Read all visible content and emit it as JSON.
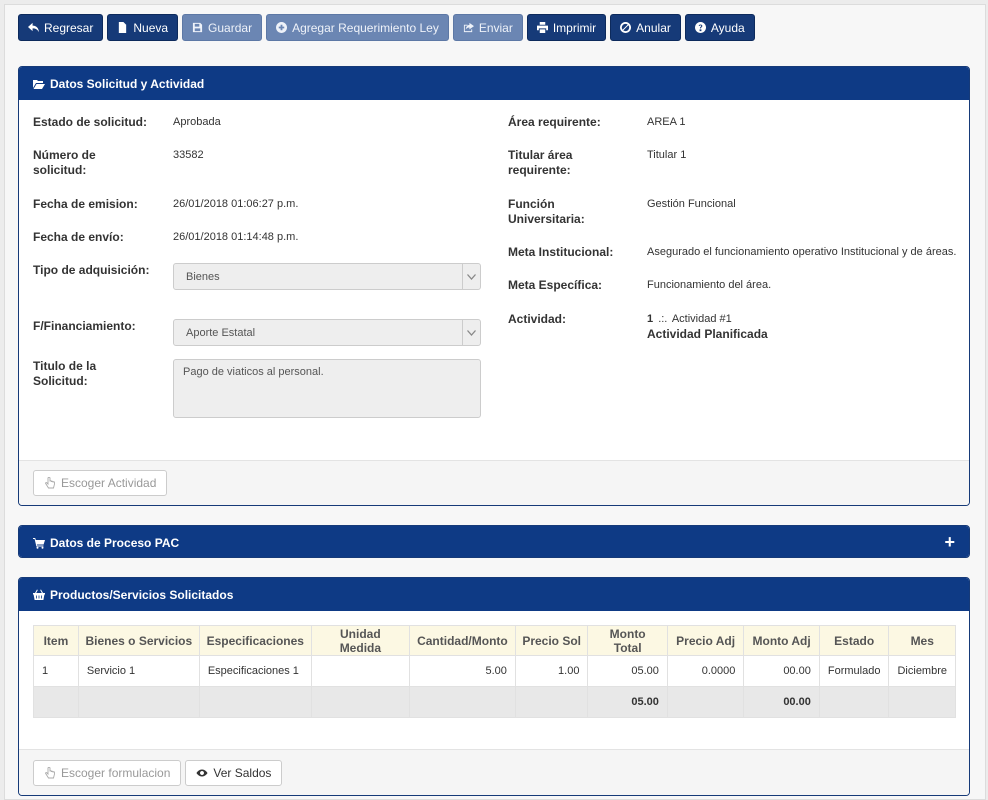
{
  "toolbar": {
    "regresar": "Regresar",
    "nueva": "Nueva",
    "guardar": "Guardar",
    "agregar": "Agregar Requerimiento Ley",
    "enviar": "Enviar",
    "imprimir": "Imprimir",
    "anular": "Anular",
    "ayuda": "Ayuda"
  },
  "solicitud_panel": {
    "title": "Datos Solicitud y Actividad",
    "estado_label": "Estado de solicitud:",
    "estado_value": "Aprobada",
    "numero_label_1": "Número de",
    "numero_label_2": "solicitud:",
    "numero_value": "33582",
    "fecha_emision_label": "Fecha de emision:",
    "fecha_emision_value": "26/01/2018 01:06:27 p.m.",
    "fecha_envio_label": "Fecha de envío:",
    "fecha_envio_value": "26/01/2018 01:14:48 p.m.",
    "tipo_label": "Tipo de adquisición:",
    "tipo_value": "Bienes",
    "financiamiento_label": "F/Financiamiento:",
    "financiamiento_value": "Aporte Estatal",
    "titulo_label_1": "Titulo de la",
    "titulo_label_2": "Solicitud:",
    "titulo_value": "Pago de viaticos al personal.",
    "area_label": "Área requirente:",
    "area_value": "AREA 1",
    "titular_label_1": "Titular área",
    "titular_label_2": "requirente:",
    "titular_value": "Titular 1",
    "funcion_label_1": "Función",
    "funcion_label_2": "Universitaria:",
    "funcion_value": "Gestión Funcional",
    "meta_inst_label": "Meta Institucional:",
    "meta_inst_value": "Asegurado el funcionamiento operativo Institucional y de áreas.",
    "meta_esp_label": "Meta Específica:",
    "meta_esp_value": "Funcionamiento del área.",
    "actividad_label": "Actividad:",
    "actividad_num": "1",
    "actividad_sep": ".:.",
    "actividad_name": "Actividad #1",
    "actividad_status": "Actividad Planificada",
    "escoger_actividad": "Escoger Actividad"
  },
  "pac_panel": {
    "title": "Datos de Proceso PAC",
    "expand": "+"
  },
  "productos_panel": {
    "title": "Productos/Servicios Solicitados",
    "columns": [
      "Item",
      "Bienes o Servicios",
      "Especificaciones",
      "Unidad Medida",
      "Cantidad/Monto",
      "Precio Sol",
      "Monto Total",
      "Precio Adj",
      "Monto Adj",
      "Estado",
      "Mes"
    ],
    "rows": [
      [
        "1",
        "Servicio 1",
        "Especificaciones 1",
        "",
        "5.00",
        "1.00",
        "05.00",
        "0.0000",
        "00.00",
        "Formulado",
        "Diciembre"
      ]
    ],
    "totals": {
      "monto_total": "05.00",
      "monto_adj": "00.00"
    },
    "escoger_formulacion": "Escoger formulacion",
    "ver_saldos": "Ver Saldos"
  },
  "colors": {
    "primary": "#163a78",
    "header": "#0e3a85",
    "disabled": "#6b86b3",
    "table_header": "#fcf8e3"
  }
}
